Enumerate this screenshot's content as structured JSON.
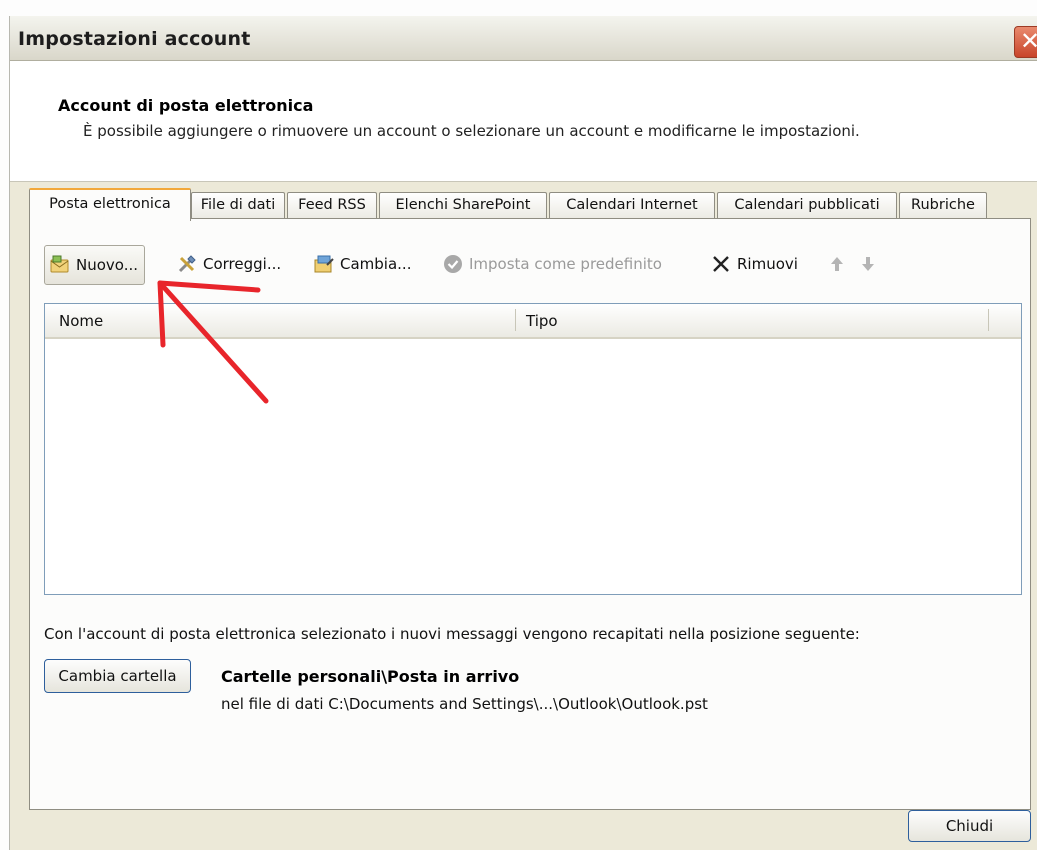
{
  "window": {
    "title": "Impostazioni account",
    "close_label": "✕"
  },
  "header": {
    "title": "Account di posta elettronica",
    "subtitle": "È possibile aggiungere o rimuovere un account o selezionare un account e modificarne le impostazioni."
  },
  "tabs": [
    {
      "label": "Posta elettronica",
      "active": true
    },
    {
      "label": "File di dati"
    },
    {
      "label": "Feed RSS"
    },
    {
      "label": "Elenchi SharePoint"
    },
    {
      "label": "Calendari Internet"
    },
    {
      "label": "Calendari pubblicati"
    },
    {
      "label": "Rubriche"
    }
  ],
  "toolbar": {
    "new_label": "Nuovo...",
    "repair_label": "Correggi...",
    "change_label": "Cambia...",
    "default_label": "Imposta come predefinito",
    "remove_label": "Rimuovi",
    "icons": [
      "mail-new-icon",
      "tools-icon",
      "change-icon",
      "check-circle-icon",
      "x-icon",
      "arrow-up-icon",
      "arrow-down-icon"
    ]
  },
  "list": {
    "columns": [
      "Nome",
      "Tipo"
    ],
    "rows": []
  },
  "delivery": {
    "description": "Con l'account di posta elettronica selezionato i nuovi messaggi vengono recapitati nella posizione seguente:",
    "change_folder_label": "Cambia cartella",
    "folder": "Cartelle personali\\Posta in arrivo",
    "path": "nel file di dati C:\\Documents and Settings\\...\\Outlook\\Outlook.pst"
  },
  "footer": {
    "close_label": "Chiudi"
  },
  "colors": {
    "annotation": "#e8252b",
    "active_tab": "#f2a83a"
  }
}
